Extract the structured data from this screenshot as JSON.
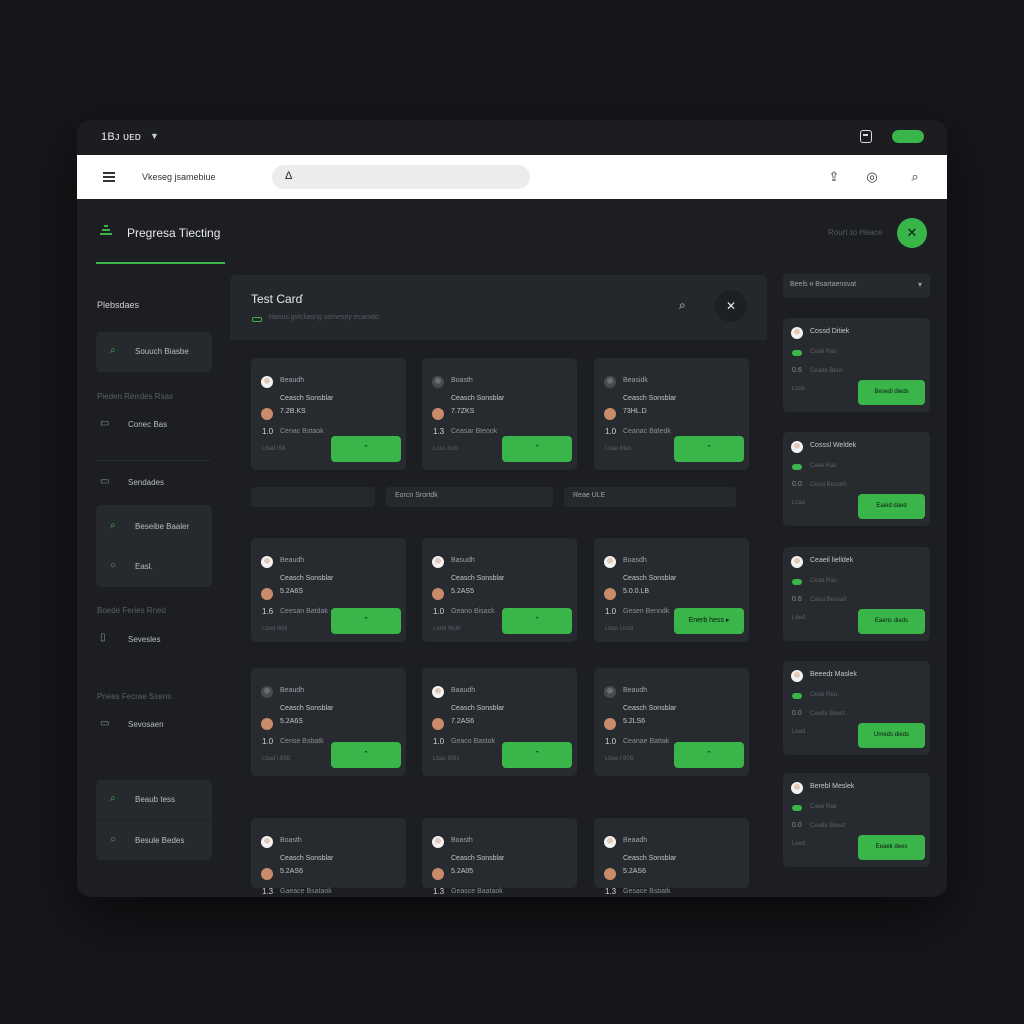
{
  "topbar": {
    "title": "1Bᴊ ᴜᴇᴅ"
  },
  "toolbar": {
    "title": "Vkeseg jsamebiue",
    "search_icon": "Δ"
  },
  "nav": {
    "title": "Pregresa Tiecting",
    "section1": "Plebsdaes",
    "box1_item": "Souuch Biasbe",
    "faint1": "Pieden Rerrdes Rsas",
    "item_coneo": "Conec Bas",
    "item_sendades": "Sendades",
    "box2_item1": "Beseibe Baaler",
    "box2_item2": "Easl.",
    "faint2": "Boede Feries Rned",
    "item_sevesles": "Sevesles",
    "faint3": "Pnees Fecrae Ssens",
    "item_sevosaen": "Sevosaen",
    "box3_item1": "Beaub tess",
    "box3_item2": "Besule Bedes"
  },
  "header": {
    "faint": "Rourt ɪo Heace"
  },
  "main": {
    "title": "Test Carɗ",
    "subtitle": "Hasus gvtcliasrig somesny ecamdo.",
    "segments": [
      "",
      "Eorcn Srortdk",
      "Reae ULE"
    ],
    "cards": [
      {
        "name": "Beaudh",
        "line1": "Ceasch Sonsblar",
        "line2": "7.2B.KS",
        "num": "1.0",
        "small": "Cenac Bstaok",
        "faint": "Lbad lSti",
        "btn": "⌃",
        "av": "light"
      },
      {
        "name": "Boasth",
        "line1": "Ceasch Sonsblar",
        "line2": "7.7ZKS",
        "num": "1.3",
        "small": "Ceasar Bteook",
        "faint": "Loss lscb",
        "btn": "⌃",
        "av": "dark"
      },
      {
        "name": "Beasidk",
        "line1": "Ceasch Sonsblar",
        "line2": "73HL.D",
        "num": "1.0",
        "small": "Ceanac Batedk",
        "faint": "Lbao Mas",
        "btn": "⌃",
        "av": "dark"
      },
      {
        "name": "Beaudh",
        "line1": "Ceasch Sonsblar",
        "line2": "5.2A6S",
        "num": "1.6",
        "small": "Ceesan Batdak",
        "faint": "Lbad Wdl",
        "btn": "⌃",
        "av": "light"
      },
      {
        "name": "Basudh",
        "line1": "Ceasch Sonsblar",
        "line2": "5.2AS5",
        "num": "1.0",
        "small": "Geano Bisack",
        "faint": "Lend Wuft",
        "btn": "⌃",
        "av": "light"
      },
      {
        "name": "Boasdh",
        "line1": "Ceasch Sonsblar",
        "line2": "5.0.0.LB",
        "num": "1.0",
        "small": "Gesen Benndk",
        "faint": "Lbas Ussb",
        "btn": "Enerb hess  ▸",
        "av": "light"
      },
      {
        "name": "Beaudh",
        "line1": "Ceasch Sonsblar",
        "line2": "5.2A6S",
        "num": "1.0",
        "small": "Cense Bsbatk",
        "faint": "Lbad l.88E",
        "btn": "⌃",
        "av": "dark"
      },
      {
        "name": "Baaudh",
        "line1": "Ceasch Sonsblar",
        "line2": "7.2AS6",
        "num": "1.0",
        "small": "Geaco Bastok",
        "faint": "Lbas l9Bs",
        "btn": "⌃",
        "av": "light"
      },
      {
        "name": "Beaudh",
        "line1": "Ceasch Sonsblar",
        "line2": "5.2LS6",
        "num": "1.0",
        "small": "Ceanae Battak",
        "faint": "Lbee l.90B",
        "btn": "⌃",
        "av": "dark"
      },
      {
        "name": "Boasth",
        "line1": "Ceasch Sonsblar",
        "line2": "5.2AS6",
        "num": "1.3",
        "small": "Gaeace Bsataok",
        "faint": "",
        "btn": "",
        "av": "light"
      },
      {
        "name": "Boasth",
        "line1": "Ceasch Sonsblar",
        "line2": "5.2A05",
        "num": "1.3",
        "small": "Geasce Baataok",
        "faint": "",
        "btn": "",
        "av": "light"
      },
      {
        "name": "Beaadh",
        "line1": "Ceasch Sonsblar",
        "line2": "5.2AS6",
        "num": "1.3",
        "small": "Gesace Bsbatk",
        "faint": "",
        "btn": "",
        "av": "light"
      }
    ]
  },
  "right": {
    "select_label": "Beels ʜ Bsartaensvat",
    "cards": [
      {
        "name": "Cossd Ditiek",
        "l1": "Cede Ras",
        "l2": "Ceade Beuc",
        "num": "0.6",
        "faint": "Lcde",
        "btn": "Besedi dieds"
      },
      {
        "name": "Cosssl Weldek",
        "l1": "Ceee Ras",
        "l2": "Cessi Besseh",
        "num": "0.0",
        "faint": "Lcad",
        "btn": "Eaeid daed"
      },
      {
        "name": "Ceaeil lielldek",
        "l1": "Ceda Ras",
        "l2": "Cassi Bessalt",
        "num": "0.6",
        "faint": "Leed",
        "btn": "Eaeris dieds"
      },
      {
        "name": "Beeedɪ Maslek",
        "l1": "Cede Reu",
        "l2": "Ceede Beuct",
        "num": "0.0",
        "faint": "Lead",
        "btn": "Umeds dieds"
      },
      {
        "name": "Berebl Meslek",
        "l1": "Caee Rak",
        "l2": "Ceade Beuat",
        "num": "0.0",
        "faint": "Leed",
        "btn": "Eeaek dees"
      }
    ]
  }
}
